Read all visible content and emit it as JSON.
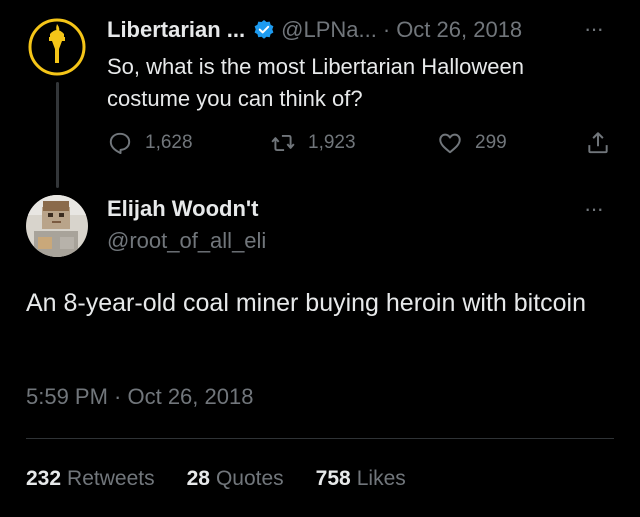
{
  "colors": {
    "background": "#000000",
    "primary_text": "#e7e9ea",
    "secondary_text": "#71767b",
    "divider": "#2f3336",
    "verified_badge": "#1d9bf0",
    "lp_logo": "#f5c518"
  },
  "parent_tweet": {
    "author_name": "Libertarian ...",
    "handle": "@LPNa...",
    "separator": "·",
    "date": "Oct 26, 2018",
    "avatar_icon": "torch-logo-icon",
    "verified_icon": "verified-badge-icon",
    "text": "So, what is the most Libertarian Halloween costume you can think of?",
    "actions": {
      "replies": "1,628",
      "retweets": "1,923",
      "likes": "299"
    }
  },
  "reply_tweet": {
    "author_name": "Elijah Woodn't",
    "handle": "@root_of_all_eli",
    "avatar_icon": "profile-avatar-icon",
    "text": "An 8-year-old coal miner buying heroin with bitcoin",
    "timestamp": "5:59 PM · Oct 26, 2018"
  },
  "stats": {
    "retweets_count": "232",
    "retweets_label": "Retweets",
    "quotes_count": "28",
    "quotes_label": "Quotes",
    "likes_count": "758",
    "likes_label": "Likes"
  },
  "more_glyph": "···"
}
